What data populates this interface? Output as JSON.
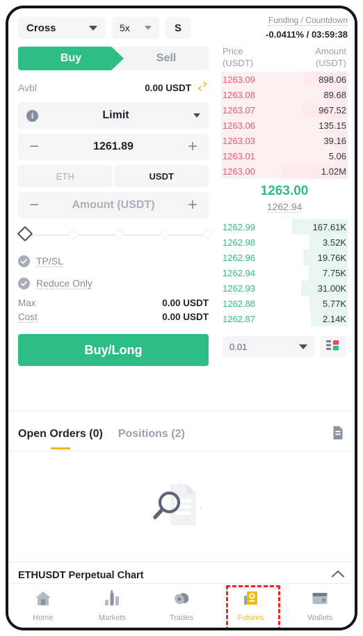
{
  "controls": {
    "margin_mode": "Cross",
    "leverage": "5x",
    "settings": "S"
  },
  "side_toggle": {
    "buy_label": "Buy",
    "sell_label": "Sell"
  },
  "available": {
    "label": "Avbl",
    "value": "0.00 USDT"
  },
  "order_type": {
    "label": "Limit",
    "info_glyph": "i"
  },
  "price_field": {
    "value": "1261.89",
    "minus": "−",
    "plus": "+"
  },
  "currency_tabs": {
    "base": "ETH",
    "quote": "USDT"
  },
  "amount_field": {
    "placeholder": "Amount (USDT)",
    "minus": "−",
    "plus": "+"
  },
  "options": {
    "tpsl_label": "TP/SL",
    "reduce_only_label": "Reduce Only"
  },
  "summary": [
    {
      "label": "Max",
      "value": "0.00 USDT"
    },
    {
      "label": "Cost",
      "value": "0.00 USDT"
    }
  ],
  "submit": {
    "label": "Buy/Long"
  },
  "orderbook": {
    "funding_label": "Funding / Countdown",
    "funding_value": "-0.0411% / 03:59:38",
    "col_price_1": "Price",
    "col_price_2": "(USDT)",
    "col_amount_1": "Amount",
    "col_amount_2": "(USDT)",
    "asks": [
      {
        "price": "1263.09",
        "amount": "898.06",
        "depth": 34
      },
      {
        "price": "1263.08",
        "amount": "89.68",
        "depth": 14
      },
      {
        "price": "1263.07",
        "amount": "967.52",
        "depth": 36
      },
      {
        "price": "1263.06",
        "amount": "135.15",
        "depth": 18
      },
      {
        "price": "1263.03",
        "amount": "39.16",
        "depth": 11
      },
      {
        "price": "1263.01",
        "amount": "5.06",
        "depth": 8
      },
      {
        "price": "1263.00",
        "amount": "1.02M",
        "depth": 52
      }
    ],
    "last_price": "1263.00",
    "index_price": "1262.94",
    "bids": [
      {
        "price": "1262.99",
        "amount": "167.61K",
        "depth": 44
      },
      {
        "price": "1262.98",
        "amount": "3.52K",
        "depth": 30
      },
      {
        "price": "1262.96",
        "amount": "19.76K",
        "depth": 35
      },
      {
        "price": "1262.94",
        "amount": "7.75K",
        "depth": 31
      },
      {
        "price": "1262.93",
        "amount": "31.00K",
        "depth": 37
      },
      {
        "price": "1262.88",
        "amount": "5.77K",
        "depth": 30
      },
      {
        "price": "1262.87",
        "amount": "2.14K",
        "depth": 29
      }
    ],
    "tick_size": "0.01"
  },
  "orders_tabs": {
    "open_orders": "Open Orders (0)",
    "positions": "Positions (2)"
  },
  "chart_bar": {
    "title": "ETHUSDT Perpetual  Chart"
  },
  "bottom_nav": [
    {
      "label": "Home",
      "icon": "home-icon",
      "active": false
    },
    {
      "label": "Markets",
      "icon": "markets-icon",
      "active": false
    },
    {
      "label": "Trades",
      "icon": "trades-icon",
      "active": false
    },
    {
      "label": "Futures",
      "icon": "futures-icon",
      "active": true
    },
    {
      "label": "Wallets",
      "icon": "wallets-icon",
      "active": false
    }
  ],
  "colors": {
    "buy_green": "#2ebd85",
    "sell_red": "#e8596b",
    "accent_yellow": "#f0b90b",
    "annotation_red": "#fb1f1f",
    "transfer_orange": "#f5b32a"
  }
}
